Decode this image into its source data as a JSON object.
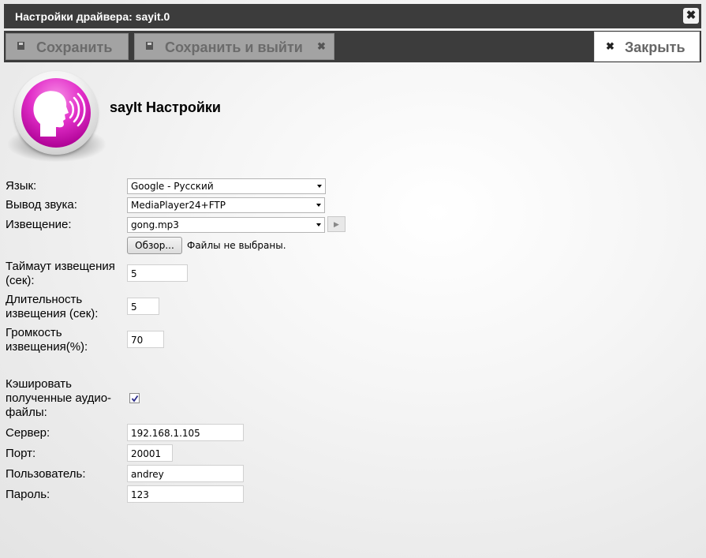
{
  "dialog": {
    "title": "Настройки драйвера: sayit.0",
    "close_glyph": "✖"
  },
  "toolbar": {
    "save_label": "Сохранить",
    "save_icon": "floppy-icon",
    "save_exit_label": "Сохранить и выйти",
    "save_exit_icon": "floppy-icon",
    "close_label": "Закрыть",
    "close_icon": "close-icon"
  },
  "header": {
    "title": "sayIt Настройки",
    "logo": "speaking-head-icon"
  },
  "form": {
    "language": {
      "label": "Язык:",
      "value": "Google - Русский"
    },
    "sound_output": {
      "label": "Вывод звука:",
      "value": "MediaPlayer24+FTP"
    },
    "announce": {
      "label": "Извещение:",
      "value": "gong.mp3",
      "play_glyph": "▶"
    },
    "file": {
      "browse_label": "Обзор...",
      "no_file_text": "Файлы не выбраны."
    },
    "announce_timeout": {
      "label_line1": "Таймаут извещения",
      "label_line2": "(сек):",
      "value": "5"
    },
    "announce_duration": {
      "label_line1": "Длительность",
      "label_line2": "извещения (сек):",
      "value": "5"
    },
    "announce_volume": {
      "label_line1": "Громкость",
      "label_line2": "извещения(%):",
      "value": "70"
    },
    "cache": {
      "label_line1": "Кэшировать",
      "label_line2": "полученные аудио-",
      "label_line3": "файлы:",
      "checked": true
    },
    "server": {
      "label": "Сервер:",
      "value": "192.168.1.105"
    },
    "port": {
      "label": "Порт:",
      "value": "20001"
    },
    "user": {
      "label": "Пользователь:",
      "value": "andrey"
    },
    "password": {
      "label": "Пароль:",
      "value": "123"
    }
  }
}
